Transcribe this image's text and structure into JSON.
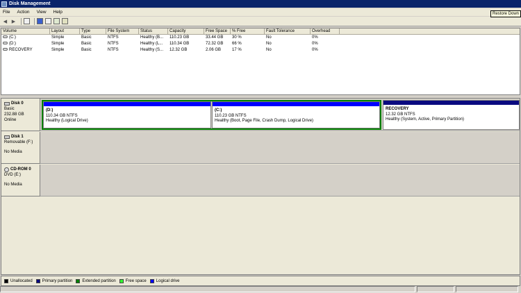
{
  "window": {
    "title": "Disk Management",
    "tooltip": "Restore Down"
  },
  "menu": [
    "File",
    "Action",
    "View",
    "Help"
  ],
  "toolbar_icons": [
    "back-arrow-icon",
    "forward-arrow-icon",
    "console-tree-icon",
    "help-icon",
    "properties-icon",
    "refresh-icon",
    "export-icon"
  ],
  "volume_list": {
    "columns": [
      "Volume",
      "Layout",
      "Type",
      "File System",
      "Status",
      "Capacity",
      "Free Space",
      "% Free",
      "Fault Tolerance",
      "Overhead"
    ],
    "rows": [
      [
        "(C:)",
        "Simple",
        "Basic",
        "NTFS",
        "Healthy (B...",
        "110.23 GB",
        "33.44 GB",
        "30 %",
        "No",
        "0%"
      ],
      [
        "(D:)",
        "Simple",
        "Basic",
        "NTFS",
        "Healthy (L...",
        "110.34 GB",
        "72.32 GB",
        "66 %",
        "No",
        "0%"
      ],
      [
        "RECOVERY",
        "Simple",
        "Basic",
        "NTFS",
        "Healthy (S...",
        "12.32 GB",
        "2.06 GB",
        "17 %",
        "No",
        "0%"
      ]
    ]
  },
  "disks": [
    {
      "name": "Disk 0",
      "type": "Basic",
      "size": "232.88 GB",
      "state": "Online",
      "partitions": [
        {
          "name": "(D:)",
          "size": "110.34 GB NTFS",
          "status": "Healthy (Logical Drive)"
        },
        {
          "name": "(C:)",
          "size": "110.23 GB NTFS",
          "status": "Healthy (Boot, Page File, Crash Dump, Logical Drive)"
        },
        {
          "name": "RECOVERY",
          "size": "12.32 GB NTFS",
          "status": "Healthy (System, Active, Primary Partition)"
        }
      ]
    },
    {
      "name": "Disk 1",
      "type": "Removable (F:)",
      "state": "No Media"
    },
    {
      "name": "CD-ROM 0",
      "type": "DVD (E:)",
      "state": "No Media"
    }
  ],
  "legend": [
    {
      "label": "Unallocated",
      "color": "#000000"
    },
    {
      "label": "Primary partition",
      "color": "#0a0a80"
    },
    {
      "label": "Extended partition",
      "color": "#008000"
    },
    {
      "label": "Free space",
      "color": "#33ff33"
    },
    {
      "label": "Logical drive",
      "color": "#0000ff"
    }
  ]
}
